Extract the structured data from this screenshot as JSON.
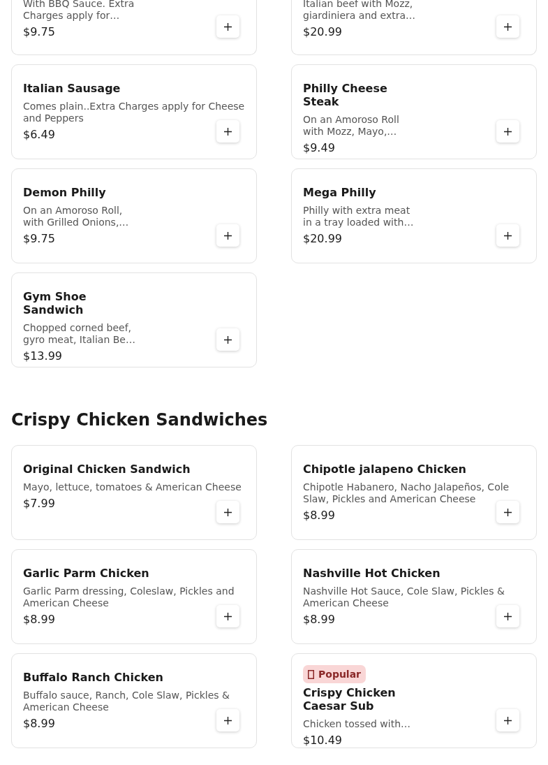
{
  "sections": [
    {
      "items": [
        {
          "kind": "partial",
          "narrow": true,
          "description": "With BBQ Sauce. Extra Charges apply for…",
          "price": "$9.75"
        },
        {
          "kind": "partial",
          "narrow": true,
          "description": "Italian beef with Mozz, giardiniera and extra…",
          "price": "$20.99"
        },
        {
          "kind": "full",
          "narrow": false,
          "name": "Italian Sausage",
          "description": "Comes plain..Extra Charges apply for Cheese and Peppers",
          "price": "$6.49"
        },
        {
          "kind": "full",
          "narrow": true,
          "name": "Philly Cheese Steak",
          "description": "On an Amoroso Roll with Mozz, Mayo,…",
          "price": "$9.49"
        },
        {
          "kind": "full",
          "narrow": true,
          "name": "Demon Philly",
          "description": "On an Amoroso Roll, with Grilled Onions,…",
          "price": "$9.75"
        },
        {
          "kind": "full",
          "narrow": true,
          "name": "Mega Philly",
          "description": "Philly with extra meat in a tray loaded with…",
          "price": "$20.99"
        },
        {
          "kind": "full",
          "narrow": true,
          "name": "Gym Shoe Sandwich",
          "description": "Chopped corned beef, gyro meat, Italian Be…",
          "price": "$13.99"
        }
      ]
    },
    {
      "title": "Crispy Chicken Sandwiches",
      "items": [
        {
          "kind": "full",
          "narrow": false,
          "name": "Original Chicken Sandwich",
          "description": "Mayo, lettuce, tomatoes & American Cheese",
          "price": "$7.99"
        },
        {
          "kind": "full",
          "narrow": false,
          "name": "Chipotle jalapeno Chicken",
          "description": "Chipotle Habanero, Nacho Jalapeños, Cole Slaw, Pickles and American Cheese",
          "price": "$8.99"
        },
        {
          "kind": "full",
          "narrow": false,
          "name": "Garlic Parm Chicken",
          "description": "Garlic Parm dressing, Coleslaw, Pickles and American Cheese",
          "price": "$8.99"
        },
        {
          "kind": "full",
          "narrow": false,
          "name": "Nashville Hot Chicken",
          "description": "Nashville Hot Sauce, Cole Slaw, Pickles & American Cheese",
          "price": "$8.99"
        },
        {
          "kind": "full",
          "narrow": false,
          "name": "Buffalo Ranch Chicken",
          "description": "Buffalo sauce, Ranch, Cole Slaw, Pickles & American Cheese",
          "price": "$8.99"
        },
        {
          "kind": "full",
          "narrow": true,
          "badge": "Popular",
          "name": "Crispy Chicken Caesar Sub",
          "description": "Chicken tossed with…",
          "price": "$10.49"
        }
      ]
    }
  ]
}
